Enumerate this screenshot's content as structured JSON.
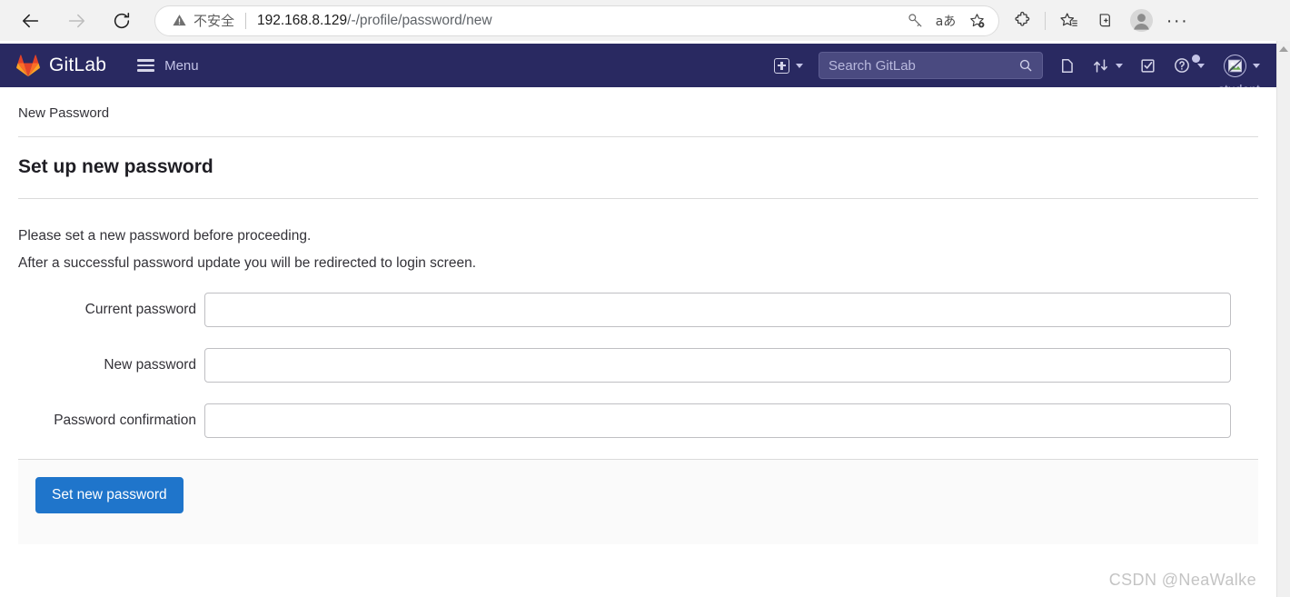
{
  "browser": {
    "back_icon": "back-arrow-icon",
    "forward_icon": "forward-arrow-icon",
    "reload_icon": "reload-icon",
    "security_label": "不安全",
    "security_icon": "warning-triangle-icon",
    "url_host": "192.168.8.129",
    "url_path": "/-/profile/password/new",
    "url_full": "192.168.8.129/-/profile/password/new",
    "omnibox_actions": [
      "key-icon",
      "translate-icon",
      "add-favorite-icon"
    ],
    "toolbar_actions": [
      "extensions-icon",
      "favorites-icon",
      "collections-icon",
      "profile-avatar",
      "more-options-icon"
    ],
    "more_label": "···"
  },
  "navbar": {
    "brand": "GitLab",
    "brand_icon": "gitlab-tanuki-icon",
    "menu_label": "Menu",
    "menu_icon": "hamburger-icon",
    "create_icon": "plus-square-icon",
    "search_placeholder": "Search GitLab",
    "search_icon": "search-icon",
    "issues_icon": "issues-icon",
    "merge_requests_icon": "merge-request-icon",
    "todos_icon": "todo-checkbox-icon",
    "help_icon": "help-question-icon",
    "user_name": "student",
    "user_avatar_icon": "broken-image-icon",
    "background": "#292961"
  },
  "page": {
    "breadcrumb": "New Password",
    "title": "Set up new password",
    "intro_line1": "Please set a new password before proceeding.",
    "intro_line2": "After a successful password update you will be redirected to login screen.",
    "form": {
      "fields": [
        {
          "label": "Current password",
          "value": "",
          "name": "current-password"
        },
        {
          "label": "New password",
          "value": "",
          "name": "new-password"
        },
        {
          "label": "Password confirmation",
          "value": "",
          "name": "password-confirmation"
        }
      ],
      "submit_label": "Set new password",
      "submit_color": "#1f75cb"
    }
  },
  "watermark": "CSDN @NeaWalke"
}
